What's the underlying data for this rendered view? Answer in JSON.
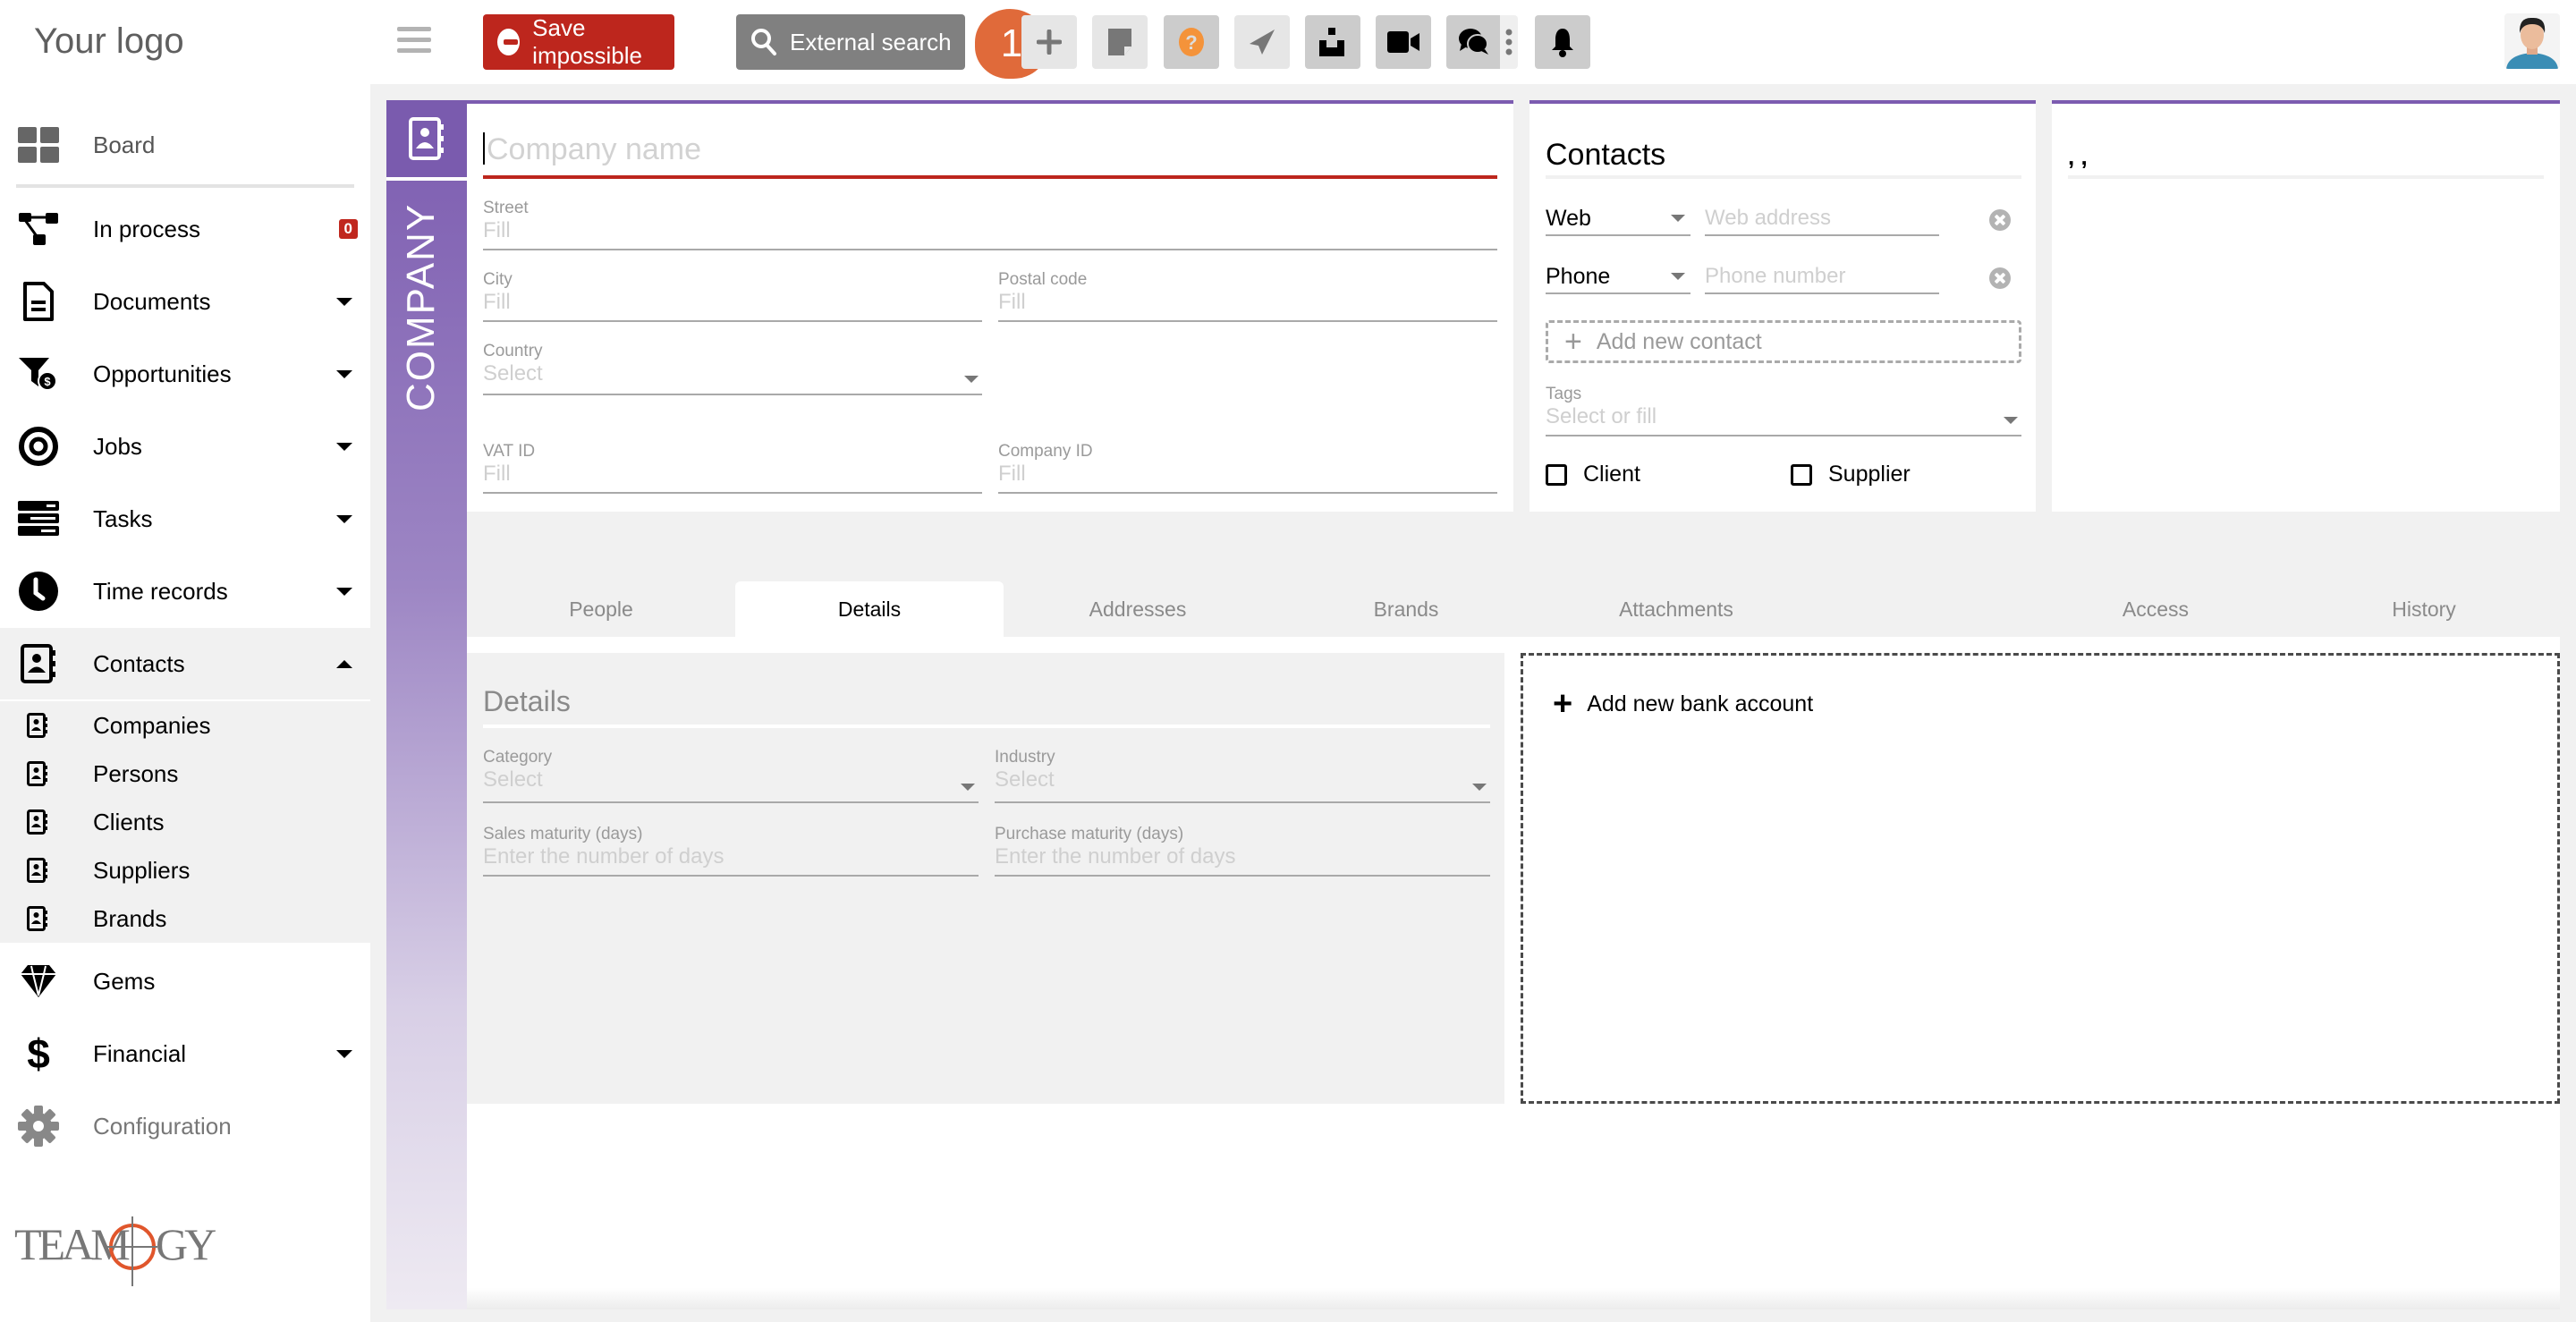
{
  "sidebar": {
    "logo": "Your logo",
    "brand": "TEAMOGY",
    "items": [
      {
        "label": "Board",
        "icon": "board-grid-icon"
      },
      {
        "label": "In process",
        "icon": "process-flow-icon",
        "badge": "0"
      },
      {
        "label": "Documents",
        "icon": "document-icon",
        "expandable": true
      },
      {
        "label": "Opportunities",
        "icon": "funnel-dollar-icon",
        "expandable": true
      },
      {
        "label": "Jobs",
        "icon": "target-icon",
        "expandable": true
      },
      {
        "label": "Tasks",
        "icon": "tasks-list-icon",
        "expandable": true
      },
      {
        "label": "Time records",
        "icon": "clock-icon",
        "expandable": true
      },
      {
        "label": "Contacts",
        "icon": "address-book-icon",
        "expanded": true
      },
      {
        "label": "Gems",
        "icon": "gem-icon"
      },
      {
        "label": "Financial",
        "icon": "dollar-icon",
        "expandable": true
      },
      {
        "label": "Configuration",
        "icon": "gear-icon"
      }
    ],
    "contacts_sub": [
      "Companies",
      "Persons",
      "Clients",
      "Suppliers",
      "Brands"
    ]
  },
  "topbar": {
    "save_label": "Save impossible",
    "external_search_label": "External search",
    "step_badge": "1",
    "tools": [
      "plus-icon",
      "note-icon",
      "help-icon",
      "send-icon",
      "inbox-icon",
      "video-icon",
      "chat-icon",
      "more-vertical-icon",
      "bell-icon",
      "user-avatar"
    ]
  },
  "entity": {
    "type_label": "COMPANY",
    "accent": "#7c5cb0",
    "error": "#bd261d"
  },
  "form": {
    "company_name_placeholder": "Company name",
    "street": {
      "label": "Street",
      "placeholder": "Fill"
    },
    "city": {
      "label": "City",
      "placeholder": "Fill"
    },
    "postal": {
      "label": "Postal code",
      "placeholder": "Fill"
    },
    "country": {
      "label": "Country",
      "placeholder": "Select"
    },
    "vat": {
      "label": "VAT ID",
      "placeholder": "Fill"
    },
    "company_id": {
      "label": "Company ID",
      "placeholder": "Fill"
    }
  },
  "contacts": {
    "title": "Contacts",
    "rows": [
      {
        "type": "Web",
        "placeholder": "Web address"
      },
      {
        "type": "Phone",
        "placeholder": "Phone number"
      }
    ],
    "add_label": "Add new contact",
    "tags_label": "Tags",
    "tags_placeholder": "Select or fill",
    "client_label": "Client",
    "supplier_label": "Supplier",
    "client_checked": false,
    "supplier_checked": false
  },
  "address_summary": ", ,",
  "tabs": [
    {
      "label": "People",
      "active": false
    },
    {
      "label": "Details",
      "active": true
    },
    {
      "label": "Addresses",
      "active": false
    },
    {
      "label": "Brands",
      "active": false
    },
    {
      "label": "Attachments",
      "active": false
    },
    {
      "label": "Access",
      "active": false
    },
    {
      "label": "History",
      "active": false
    }
  ],
  "details": {
    "title": "Details",
    "category": {
      "label": "Category",
      "placeholder": "Select"
    },
    "industry": {
      "label": "Industry",
      "placeholder": "Select"
    },
    "sales_maturity": {
      "label": "Sales maturity (days)",
      "placeholder": "Enter the number of days"
    },
    "purchase_maturity": {
      "label": "Purchase maturity (days)",
      "placeholder": "Enter the number of days"
    }
  },
  "bank": {
    "add_label": "Add new bank account"
  }
}
